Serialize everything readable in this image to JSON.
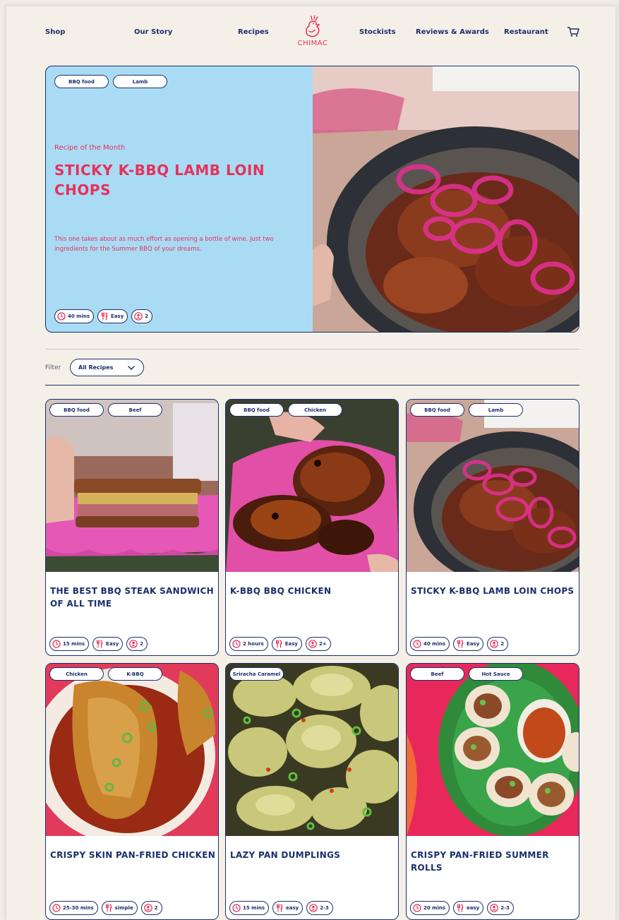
{
  "nav": {
    "items": [
      "Shop",
      "Our Story",
      "Recipes",
      "Stockists",
      "Reviews & Awards",
      "Restaurant"
    ],
    "logo_text": "CHIMAC",
    "cart_icon": "cart-icon"
  },
  "hero": {
    "tags": [
      "BBQ food",
      "Lamb"
    ],
    "eyebrow": "Recipe of the Month",
    "title": "STICKY K-BBQ LAMB LOIN CHOPS",
    "description": "This one takes about as much effort as opening a bottle of wine. Just two ingredients for the Summer BBQ of your dreams.",
    "time": "40 mins",
    "difficulty": "Easy",
    "serves": "2",
    "background": "#a9dcf4",
    "accent": "#e8305b"
  },
  "filter": {
    "label": "Filter",
    "selected": "All Recipes"
  },
  "cards": [
    {
      "tags": [
        "BBQ food",
        "Beef"
      ],
      "title": "THE BEST BBQ STEAK SANDWICH OF ALL TIME",
      "time": "15 mins",
      "difficulty": "Easy",
      "serves": "2"
    },
    {
      "tags": [
        "BBQ food",
        "Chicken"
      ],
      "title": "K-BBQ BBQ CHICKEN",
      "time": "2 hours",
      "difficulty": "Easy",
      "serves": "2+"
    },
    {
      "tags": [
        "BBQ food",
        "Lamb"
      ],
      "title": "STICKY K-BBQ LAMB LOIN CHOPS",
      "time": "40 mins",
      "difficulty": "Easy",
      "serves": "2"
    },
    {
      "tags": [
        "Chicken",
        "K-BBQ"
      ],
      "title": "CRISPY SKIN PAN-FRIED CHICKEN",
      "time": "25-30 mins",
      "difficulty": "simple",
      "serves": "2"
    },
    {
      "tags": [
        "Sriracha Caramel"
      ],
      "title": "LAZY PAN DUMPLINGS",
      "time": "15 mins",
      "difficulty": "easy",
      "serves": "2-3"
    },
    {
      "tags": [
        "Beef",
        "Hot Sauce"
      ],
      "title": "CRISPY PAN-FRIED SUMMER ROLLS",
      "time": "20 mins",
      "difficulty": "easy",
      "serves": "2-3"
    }
  ],
  "colors": {
    "navy": "#1b2f6b",
    "pink": "#e8305b",
    "page_bg": "#f4f0e8"
  }
}
